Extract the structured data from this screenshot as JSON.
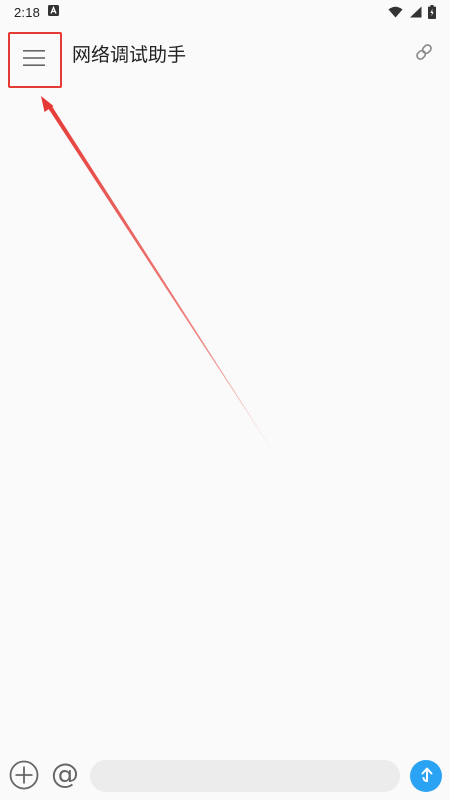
{
  "status_bar": {
    "time": "2:18",
    "notification_icon": "a-notification-icon",
    "wifi_icon": "wifi-icon",
    "signal_icon": "signal-icon",
    "battery_icon": "battery-charging-icon"
  },
  "app_bar": {
    "menu_icon": "hamburger-menu-icon",
    "title": "网络调试助手",
    "link_icon": "link-icon"
  },
  "annotation": {
    "highlight_color": "#e53935",
    "arrow_color": "#e53935"
  },
  "input_bar": {
    "add_icon": "plus-circle-icon",
    "at_label": "@",
    "message_value": "",
    "message_placeholder": "",
    "send_icon": "send-up-arrow-icon"
  },
  "colors": {
    "background": "#fafafa",
    "input_background": "#ececec",
    "send_button": "#2aa3f4"
  }
}
